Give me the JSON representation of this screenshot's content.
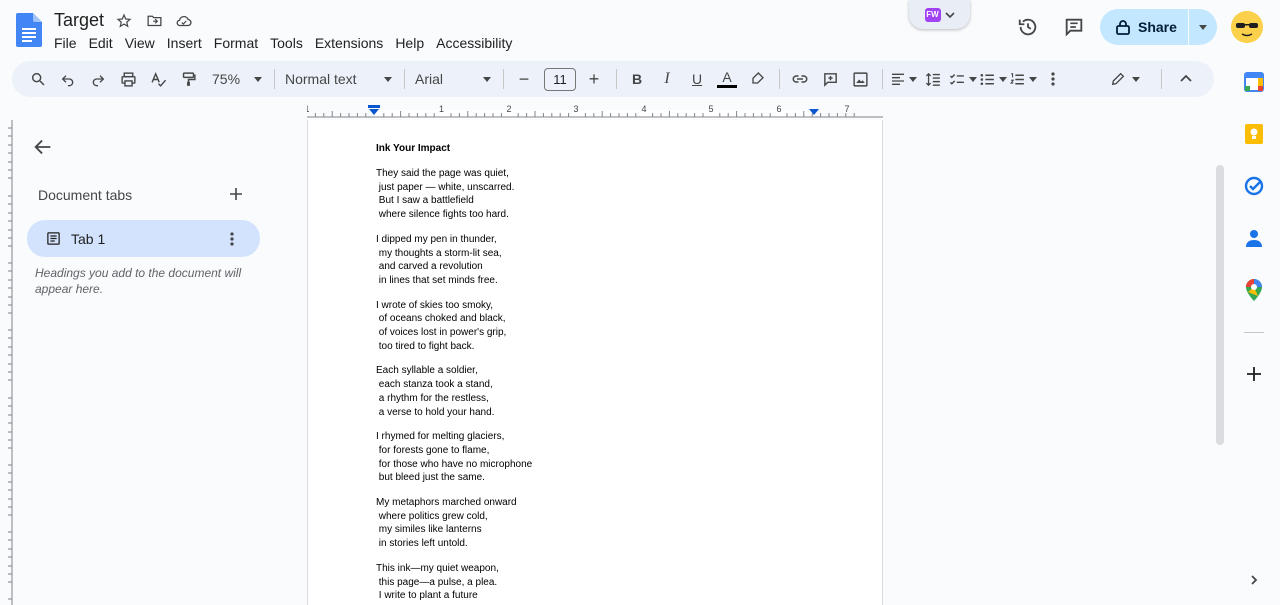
{
  "app": {
    "title": "Target",
    "menu": [
      "File",
      "Edit",
      "View",
      "Insert",
      "Format",
      "Tools",
      "Extensions",
      "Help",
      "Accessibility"
    ],
    "share_label": "Share",
    "extension_badge": "FW"
  },
  "toolbar": {
    "zoom": "75%",
    "style": "Normal text",
    "font": "Arial",
    "font_size": "11",
    "minus": "−",
    "plus": "+",
    "bold": "B",
    "italic": "I",
    "underline": "U",
    "text_color": "A"
  },
  "ruler": {
    "numbers": [
      "1",
      "1",
      "2",
      "3",
      "4",
      "5",
      "6",
      "7"
    ]
  },
  "sidebar": {
    "header": "Document tabs",
    "tab_label": "Tab 1",
    "hint": "Headings you add to the document will appear here."
  },
  "document": {
    "heading": "Ink Your Impact",
    "stanzas": [
      [
        "They said the page was quiet,",
        " just paper — white, unscarred.",
        " But I saw a battlefield",
        " where silence fights too hard."
      ],
      [
        "I dipped my pen in thunder,",
        " my thoughts a storm-lit sea,",
        " and carved a revolution",
        " in lines that set minds free."
      ],
      [
        "I wrote of skies too smoky,",
        " of oceans choked and black,",
        " of voices lost in power's grip,",
        " too tired to fight back."
      ],
      [
        "Each syllable a soldier,",
        " each stanza took a stand,",
        " a rhythm for the restless,",
        " a verse to hold your hand."
      ],
      [
        "I rhymed for melting glaciers,",
        " for forests gone to flame,",
        " for those who have no microphone",
        " but bleed just the same."
      ],
      [
        "My metaphors marched onward",
        " where politics grew cold,",
        " my similes like lanterns",
        " in stories left untold."
      ],
      [
        "This ink—my quiet weapon,",
        " this page—a pulse, a plea.",
        " I write to plant a future"
      ]
    ]
  },
  "colors": {
    "accent": "#0b57d0",
    "share_bg": "#c2e7ff",
    "tab_active_bg": "#d3e3fd",
    "toolbar_bg": "#edf2fa"
  }
}
